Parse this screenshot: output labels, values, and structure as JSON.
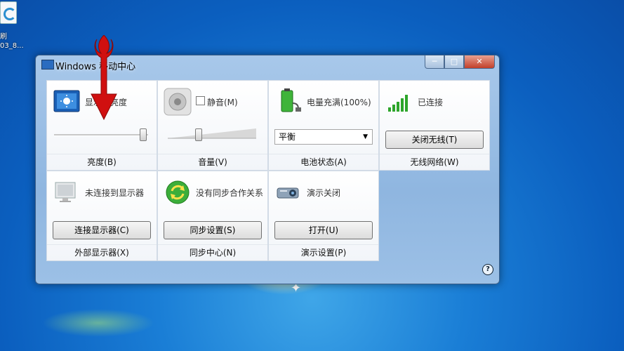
{
  "desktop": {
    "icon_label_line1": "刷",
    "icon_label_line2": "03_8..."
  },
  "window": {
    "title": "Windows 移动中心",
    "controls": {
      "minimize": "─",
      "maximize": "□",
      "close": "✕"
    },
    "help_icon": "?"
  },
  "tiles": {
    "brightness": {
      "status": "显示器亮度",
      "footer": "亮度(B)",
      "level": 0.97,
      "icon": "display-brightness-icon"
    },
    "volume": {
      "status": "静音(M)",
      "footer": "音量(V)",
      "level": 0.33,
      "icon": "speaker-icon",
      "mute_checked": false
    },
    "battery": {
      "status": "电量充满(100%)",
      "footer": "电池状态(A)",
      "select_value": "平衡",
      "icon": "battery-plug-icon"
    },
    "wireless": {
      "status": "已连接",
      "footer": "无线网络(W)",
      "button": "关闭无线(T)",
      "icon": "signal-bars-icon"
    },
    "display": {
      "status": "未连接到显示器",
      "footer": "外部显示器(X)",
      "button": "连接显示器(C)",
      "icon": "monitor-icon"
    },
    "sync": {
      "status": "没有同步合作关系",
      "footer": "同步中心(N)",
      "button": "同步设置(S)",
      "icon": "sync-icon"
    },
    "presentation": {
      "status": "演示关闭",
      "footer": "演示设置(P)",
      "button": "打开(U)",
      "icon": "projector-icon"
    }
  },
  "colors": {
    "annotation_arrow": "#d01010",
    "window_frame": "#a8c8ea"
  }
}
